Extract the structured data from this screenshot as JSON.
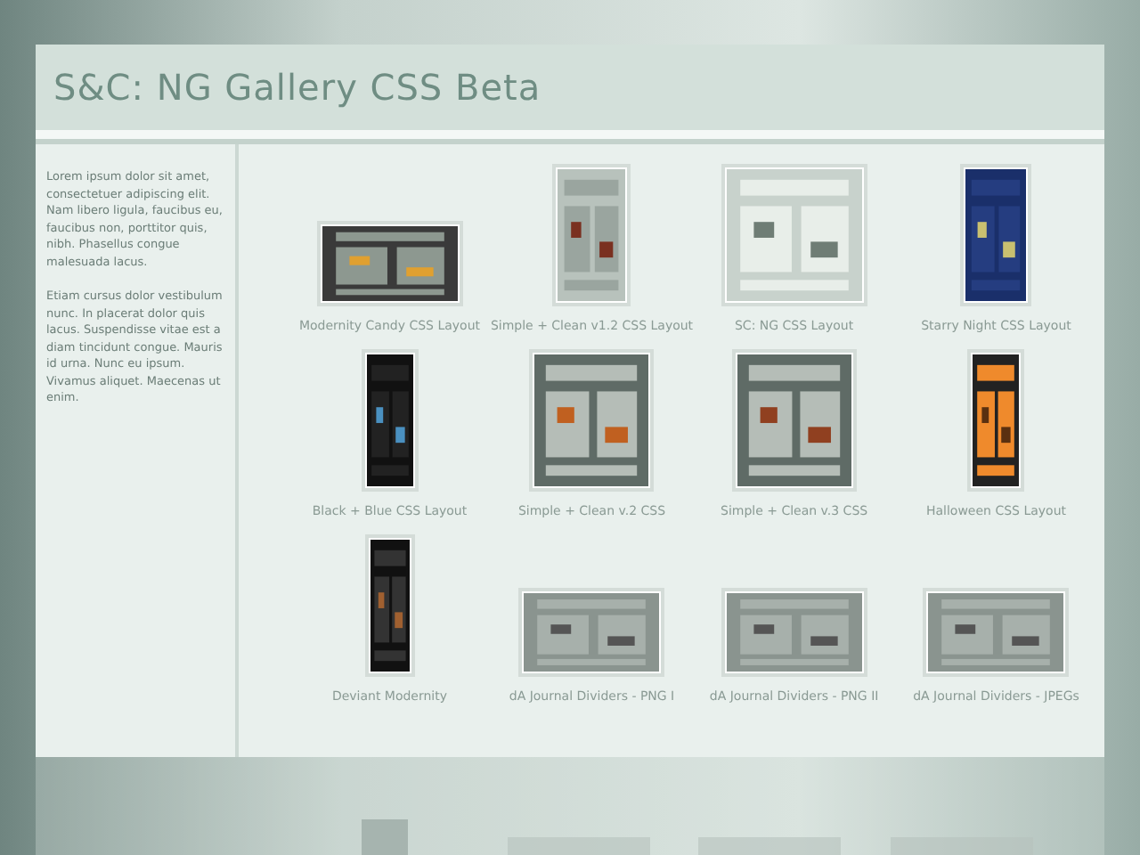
{
  "header": {
    "title": "S&C: NG Gallery CSS Beta"
  },
  "sidebar": {
    "paragraphs": [
      "Lorem ipsum dolor sit amet, consectetuer adipiscing elit. Nam libero ligula, faucibus eu, faucibus non, porttitor quis, nibh. Phasellus congue malesuada lacus.",
      "Etiam cursus dolor vestibulum nunc. In placerat dolor quis lacus. Suspendisse vitae est a diam tincidunt congue. Mauris id urna. Nunc eu ipsum. Vivamus aliquet. Maecenas ut enim."
    ]
  },
  "gallery": [
    {
      "caption": "Modernity Candy CSS Layout",
      "kind": "picture"
    },
    {
      "caption": "Simple + Clean v1.2 CSS Layout",
      "kind": "picture"
    },
    {
      "caption": "SC: NG CSS Layout",
      "kind": "picture"
    },
    {
      "caption": "Starry Night CSS Layout",
      "kind": "picture"
    },
    {
      "caption": "Black + Blue CSS Layout",
      "kind": "picture"
    },
    {
      "caption": "Simple + Clean v.2 CSS",
      "kind": "picture"
    },
    {
      "caption": "Simple + Clean v.3 CSS",
      "kind": "picture"
    },
    {
      "caption": "Halloween CSS Layout",
      "kind": "picture"
    },
    {
      "caption": "Deviant Modernity",
      "kind": "picture"
    },
    {
      "caption": "dA Journal Dividers - PNG I",
      "kind": "picture"
    },
    {
      "caption": "dA Journal Dividers - PNG II",
      "kind": "picture"
    },
    {
      "caption": "dA Journal Dividers - JPEGs",
      "kind": "picture"
    }
  ]
}
